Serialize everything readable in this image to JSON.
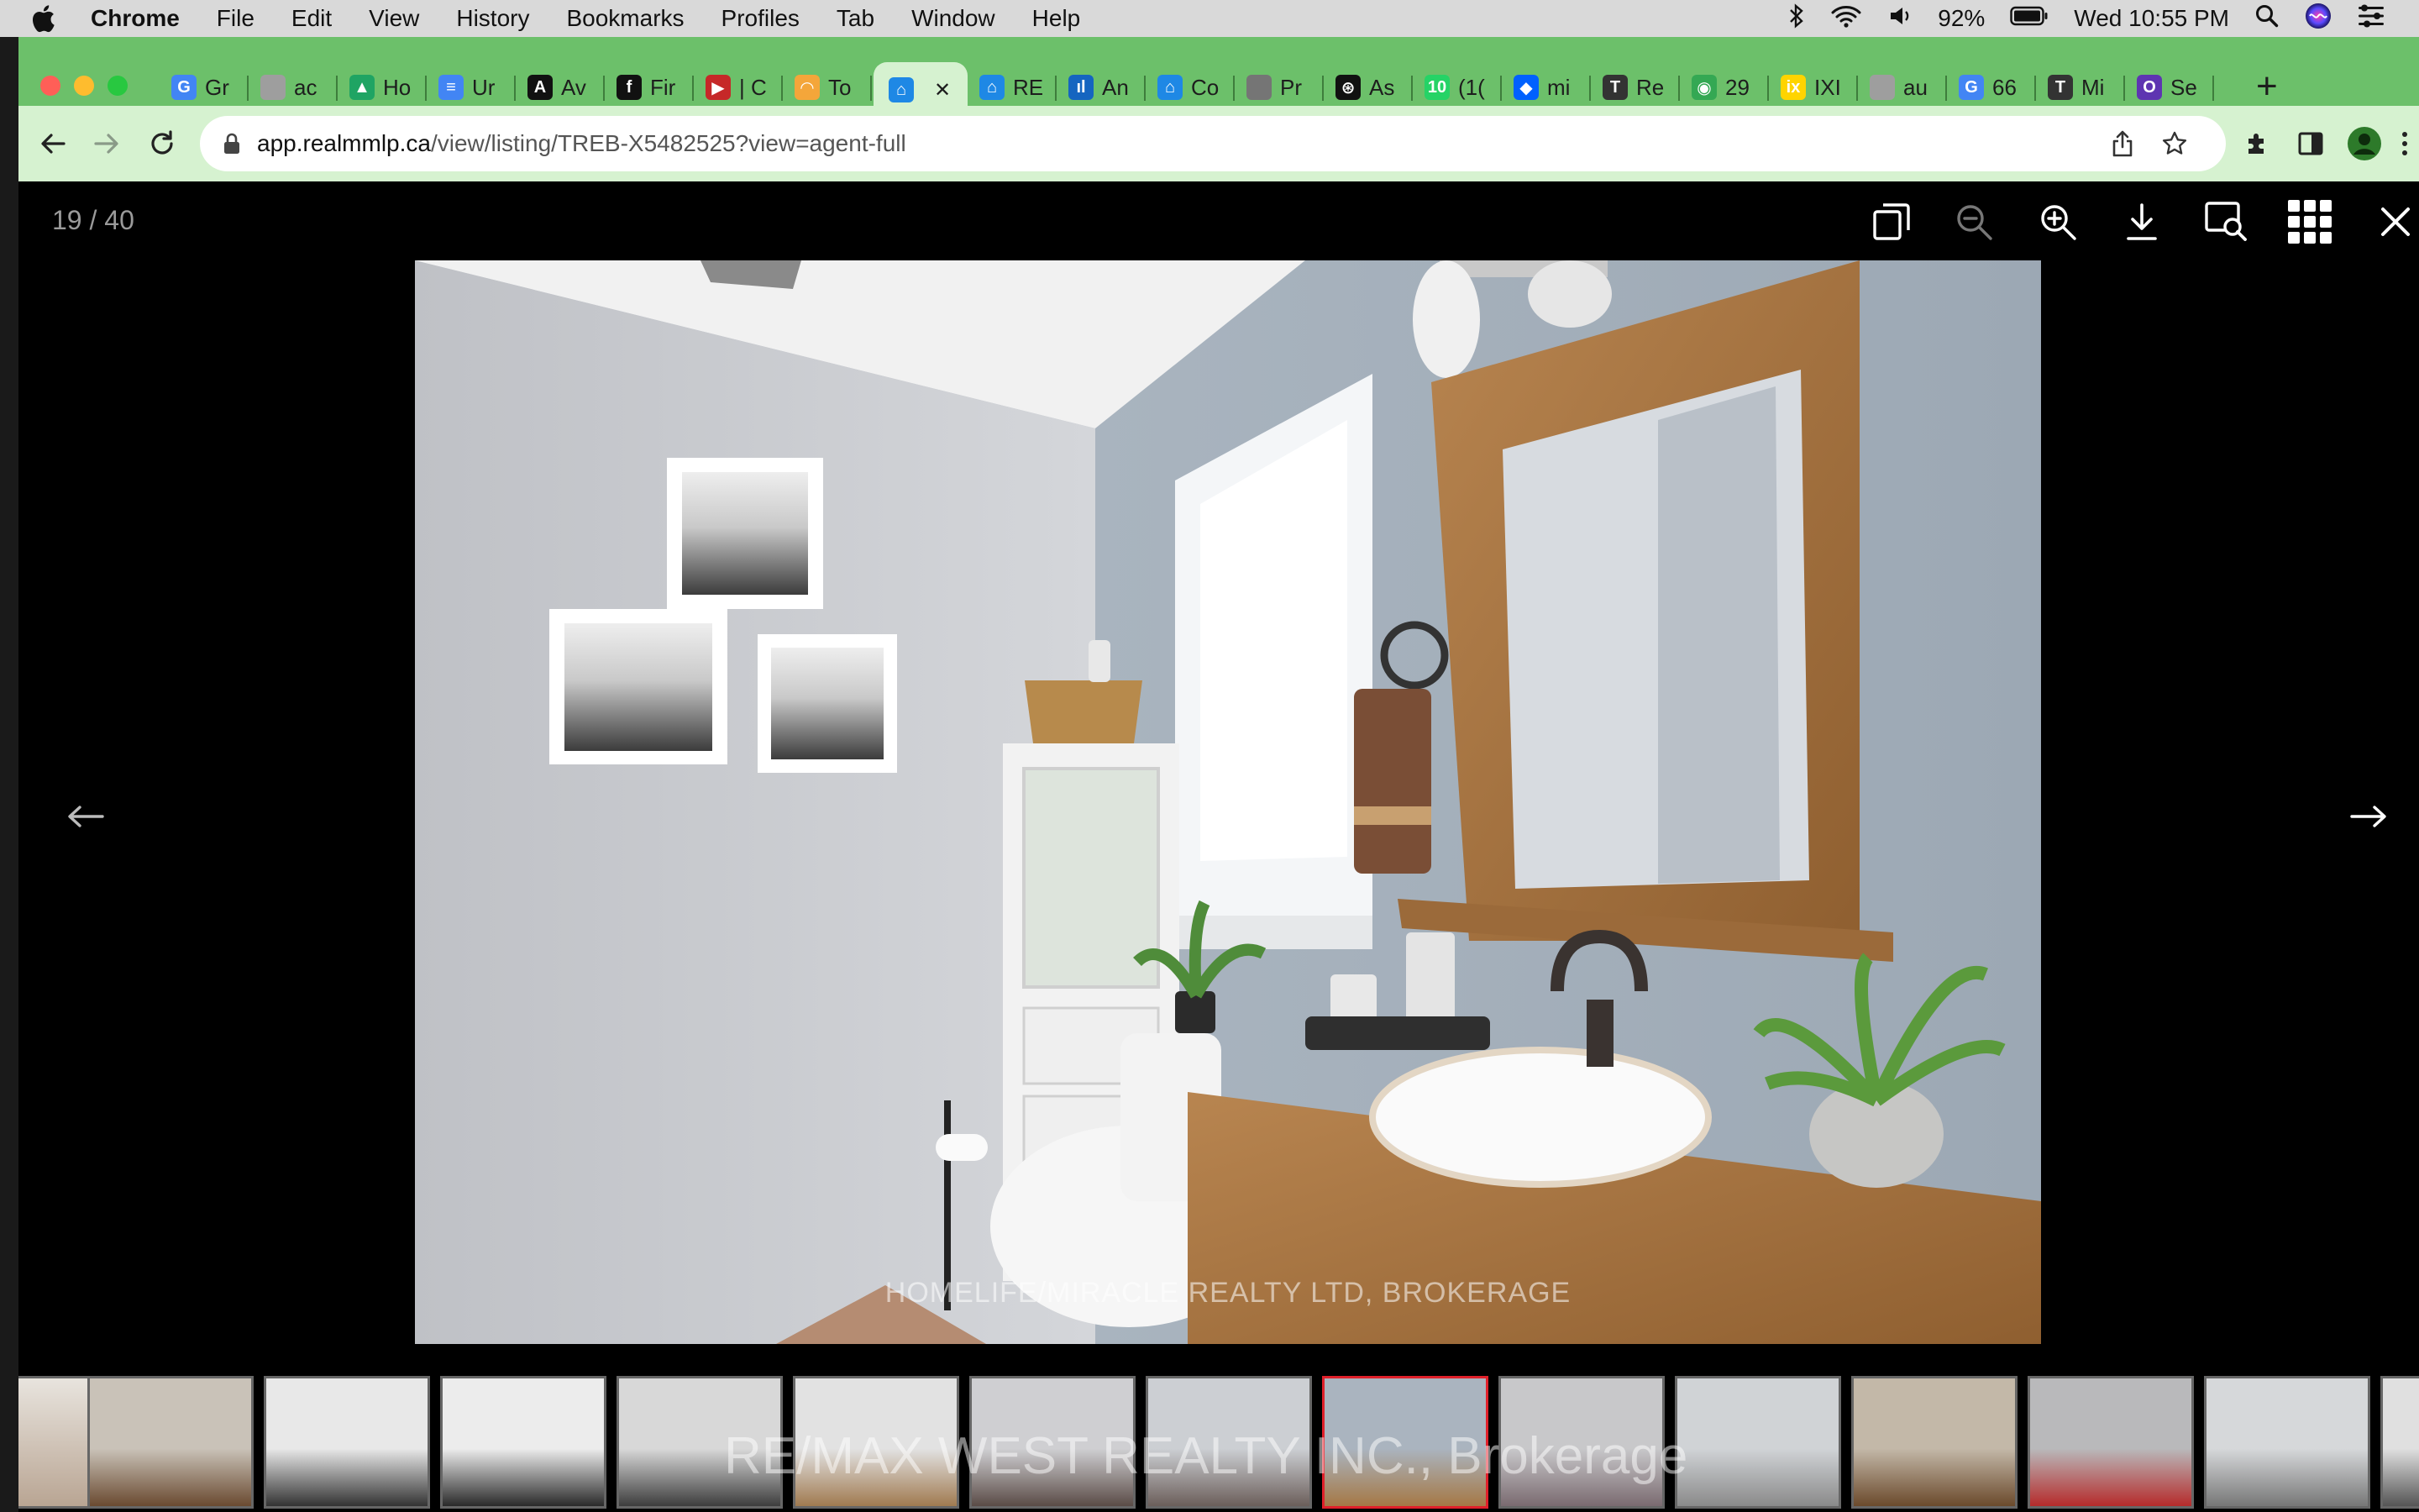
{
  "menubar": {
    "app": "Chrome",
    "items": [
      "File",
      "Edit",
      "View",
      "History",
      "Bookmarks",
      "Profiles",
      "Tab",
      "Window",
      "Help"
    ],
    "battery": "92%",
    "clock": "Wed 10:55 PM"
  },
  "tabs": [
    {
      "label": "Gr",
      "fav": "G",
      "color": "#4285f4"
    },
    {
      "label": "ac",
      "fav": "",
      "color": "#9e9e9e"
    },
    {
      "label": "Ho",
      "fav": "▲",
      "color": "#1fa463"
    },
    {
      "label": "Ur",
      "fav": "≡",
      "color": "#4285f4"
    },
    {
      "label": "Av",
      "fav": "A",
      "color": "#111111"
    },
    {
      "label": "Fir",
      "fav": "f",
      "color": "#111111"
    },
    {
      "label": "| C",
      "fav": "▶",
      "color": "#c62828"
    },
    {
      "label": "To",
      "fav": "◠",
      "color": "#f4a63a"
    },
    {
      "label": "",
      "fav": "⌂",
      "color": "#1e88e5"
    },
    {
      "label": "RE",
      "fav": "⌂",
      "color": "#1e88e5"
    },
    {
      "label": "An",
      "fav": "ıl",
      "color": "#1565c0"
    },
    {
      "label": "Co",
      "fav": "⌂",
      "color": "#1e88e5"
    },
    {
      "label": "Pr",
      "fav": "",
      "color": "#757575"
    },
    {
      "label": "As",
      "fav": "⊛",
      "color": "#111111"
    },
    {
      "label": "(1(",
      "fav": "10",
      "color": "#25d366"
    },
    {
      "label": "mi",
      "fav": "◆",
      "color": "#0061fe"
    },
    {
      "label": "Re",
      "fav": "T",
      "color": "#333333"
    },
    {
      "label": "29",
      "fav": "◉",
      "color": "#34a853"
    },
    {
      "label": "IXI",
      "fav": "ix",
      "color": "#ffd400"
    },
    {
      "label": "au",
      "fav": "",
      "color": "#9e9e9e"
    },
    {
      "label": "66",
      "fav": "G",
      "color": "#4285f4"
    },
    {
      "label": "Mi",
      "fav": "T",
      "color": "#333333"
    },
    {
      "label": "Se",
      "fav": "O",
      "color": "#5e35b1"
    }
  ],
  "address": {
    "host": "app.realmmlp.ca",
    "path": "/view/listing/TREB-X5482525?view=agent-full"
  },
  "viewer": {
    "counter": "19 / 40",
    "watermark": "HOMELIFE/MIRACLE REALTY LTD, BROKERAGE",
    "strip_watermark": "RE/MAX WEST REALTY INC., Brokerage",
    "selected_index": 7
  },
  "thumbnails": [
    {
      "name": "dining"
    },
    {
      "name": "kitchen-island"
    },
    {
      "name": "kitchen-wide"
    },
    {
      "name": "kitchen-range"
    },
    {
      "name": "hallway"
    },
    {
      "name": "bedroom-1"
    },
    {
      "name": "bedroom-1b"
    },
    {
      "name": "bathroom"
    },
    {
      "name": "bedroom-2"
    },
    {
      "name": "bedroom-2b"
    },
    {
      "name": "ensuite"
    },
    {
      "name": "bedroom-3"
    },
    {
      "name": "bedroom-3b"
    },
    {
      "name": "laundry"
    }
  ]
}
